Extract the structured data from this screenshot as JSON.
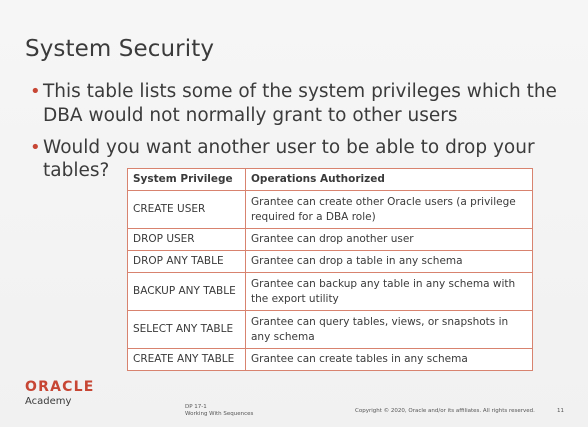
{
  "slide": {
    "title": "System Security",
    "bullets": [
      "This table lists some of the system privileges which the DBA would not normally grant to other users",
      "Would you want another user to be able to drop your"
    ],
    "bullet2_line2": "tables?"
  },
  "table": {
    "headers": [
      "System Privilege",
      "Operations Authorized"
    ],
    "rows": [
      [
        "CREATE USER",
        "Grantee can create other Oracle users (a privilege required for a DBA role)"
      ],
      [
        "DROP USER",
        "Grantee can drop another user"
      ],
      [
        "DROP ANY TABLE",
        "Grantee can drop a table in any schema"
      ],
      [
        "BACKUP ANY TABLE",
        "Grantee can backup any table in any schema with the export utility"
      ],
      [
        "SELECT ANY TABLE",
        "Grantee can query tables, views, or snapshots in any schema"
      ],
      [
        "CREATE ANY TABLE",
        "Grantee can create tables in any schema"
      ]
    ]
  },
  "footer": {
    "logo_brand": "ORACLE",
    "logo_sub": "Academy",
    "course_code": "DP 17-1",
    "course_title": "Working With Sequences",
    "copyright": "Copyright © 2020, Oracle and/or its affiliates. All rights reserved.",
    "page_number": "11"
  },
  "colors": {
    "accent": "#c74634",
    "table_border": "#d8836f",
    "text": "#3b3b3b"
  }
}
